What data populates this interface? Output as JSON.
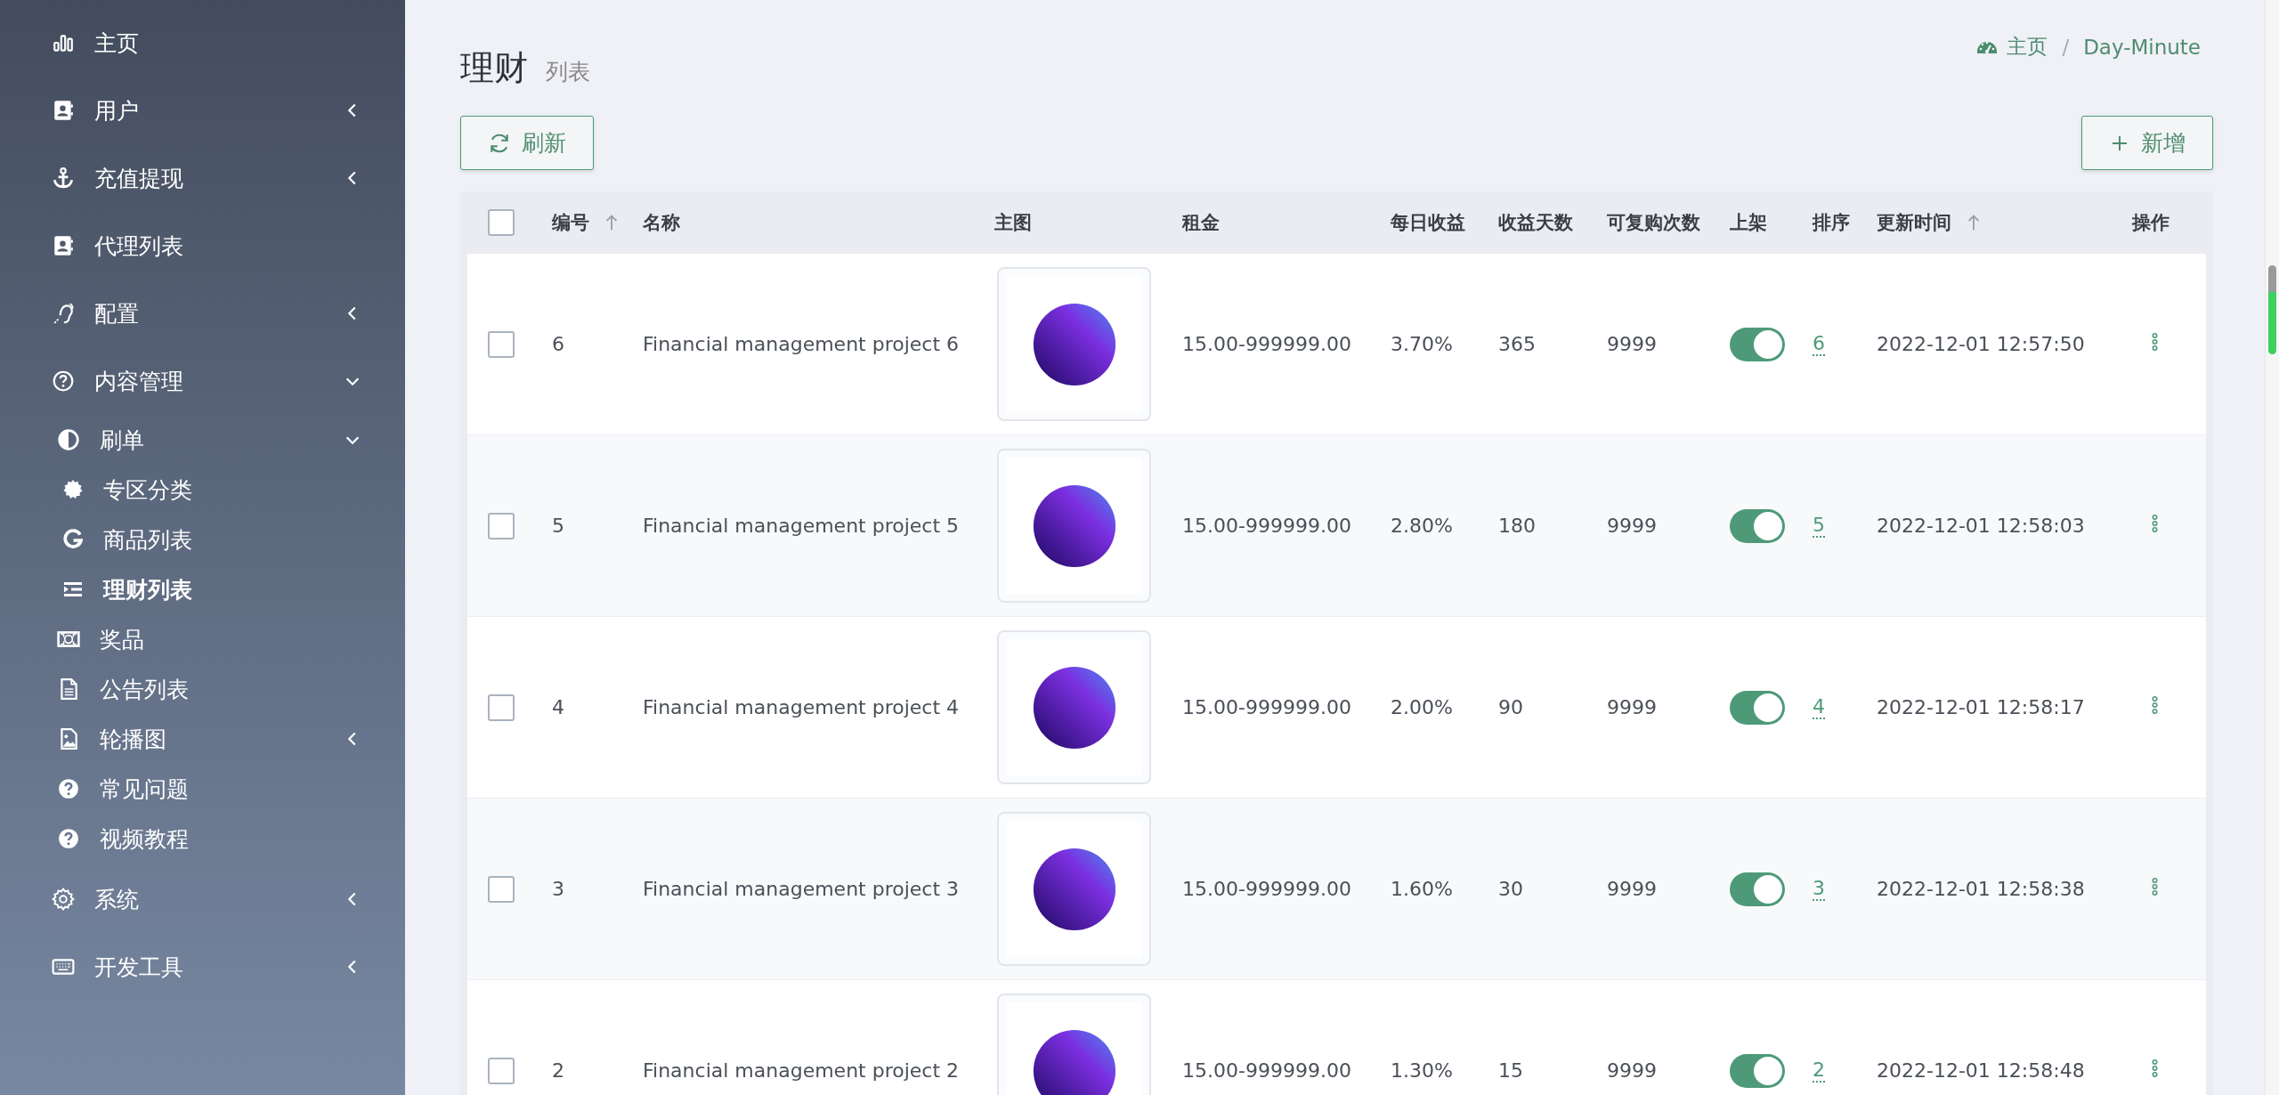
{
  "sidebar": {
    "items": [
      {
        "label": "主页",
        "selected": false
      },
      {
        "label": "用户",
        "selected": false,
        "expanded": false
      },
      {
        "label": "充值提现",
        "selected": false,
        "expanded": false
      },
      {
        "label": "代理列表",
        "selected": false
      },
      {
        "label": "配置",
        "selected": false,
        "expanded": false
      },
      {
        "label": "内容管理",
        "selected": false,
        "expanded": true,
        "children": [
          {
            "label": "刷单",
            "selected": false,
            "expanded": true,
            "children": [
              {
                "label": "专区分类",
                "selected": false
              },
              {
                "label": "商品列表",
                "selected": false
              },
              {
                "label": "理财列表",
                "selected": true
              }
            ]
          },
          {
            "label": "奖品",
            "selected": false
          },
          {
            "label": "公告列表",
            "selected": false
          },
          {
            "label": "轮播图",
            "selected": false,
            "expanded": false
          },
          {
            "label": "常见问题",
            "selected": false
          },
          {
            "label": "视频教程",
            "selected": false
          }
        ]
      },
      {
        "label": "系统",
        "selected": false,
        "expanded": false
      },
      {
        "label": "开发工具",
        "selected": false,
        "expanded": false
      }
    ]
  },
  "header": {
    "title": "理财",
    "subtitle": "列表",
    "breadcrumb": {
      "separator": "/",
      "items": [
        "主页",
        "Day-Minute"
      ]
    }
  },
  "toolbar": {
    "refresh_button": "刷新",
    "add_button": "新增"
  },
  "table": {
    "select_all_checked": false,
    "columns": [
      {
        "label": "编号",
        "sortable": true
      },
      {
        "label": "名称",
        "sortable": false
      },
      {
        "label": "主图",
        "sortable": false
      },
      {
        "label": "租金",
        "sortable": false
      },
      {
        "label": "每日收益",
        "sortable": false
      },
      {
        "label": "收益天数",
        "sortable": false
      },
      {
        "label": "可复购次数",
        "sortable": false
      },
      {
        "label": "上架",
        "sortable": false
      },
      {
        "label": "排序",
        "sortable": false
      },
      {
        "label": "更新时间",
        "sortable": true
      },
      {
        "label": "操作",
        "sortable": false
      }
    ],
    "rows": [
      {
        "checked": false,
        "id": "6",
        "name": "Financial management project 6",
        "rent": "15.00-999999.00",
        "daily_return": "3.70%",
        "days": "365",
        "repurchase": "9999",
        "on": true,
        "sort": "6",
        "updated": "2022-12-01 12:57:50"
      },
      {
        "checked": false,
        "id": "5",
        "name": "Financial management project 5",
        "rent": "15.00-999999.00",
        "daily_return": "2.80%",
        "days": "180",
        "repurchase": "9999",
        "on": true,
        "sort": "5",
        "updated": "2022-12-01 12:58:03"
      },
      {
        "checked": false,
        "id": "4",
        "name": "Financial management project 4",
        "rent": "15.00-999999.00",
        "daily_return": "2.00%",
        "days": "90",
        "repurchase": "9999",
        "on": true,
        "sort": "4",
        "updated": "2022-12-01 12:58:17"
      },
      {
        "checked": false,
        "id": "3",
        "name": "Financial management project 3",
        "rent": "15.00-999999.00",
        "daily_return": "1.60%",
        "days": "30",
        "repurchase": "9999",
        "on": true,
        "sort": "3",
        "updated": "2022-12-01 12:58:38"
      },
      {
        "checked": false,
        "id": "2",
        "name": "Financial management project 2",
        "rent": "15.00-999999.00",
        "daily_return": "1.30%",
        "days": "15",
        "repurchase": "9999",
        "on": true,
        "sort": "2",
        "updated": "2022-12-01 12:58:48"
      }
    ]
  }
}
